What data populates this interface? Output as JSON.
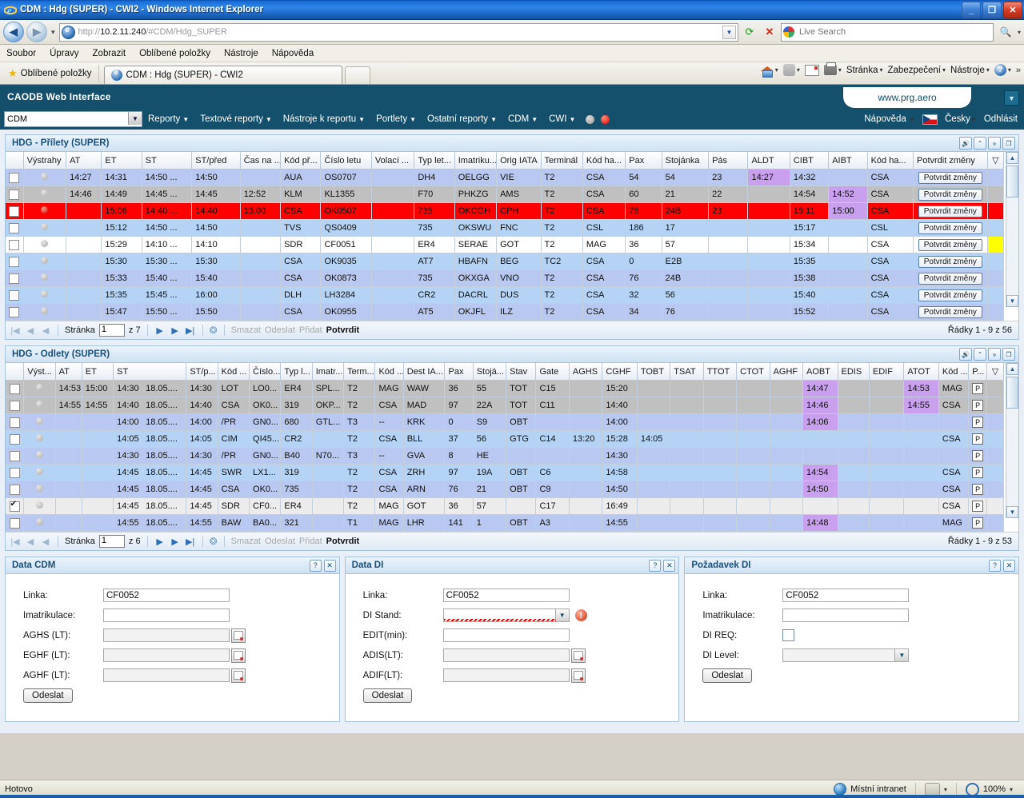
{
  "browser": {
    "title": "CDM : Hdg (SUPER) - CWI2 - Windows Internet Explorer",
    "url_scheme": "http://",
    "url_host": "10.2.11.240",
    "url_path": "/#CDM/Hdg_SUPER",
    "search_placeholder": "Live Search",
    "menu": [
      "Soubor",
      "Úpravy",
      "Zobrazit",
      "Oblíbené položky",
      "Nástroje",
      "Nápověda"
    ],
    "favorites_label": "Oblíbené položky",
    "tab_label": "CDM : Hdg (SUPER) - CWI2",
    "command_bar": [
      "Stránka",
      "Zabezpečení",
      "Nástroje"
    ],
    "status_text": "Hotovo",
    "zone_text": "Místní intranet",
    "zoom_level": "100%"
  },
  "app": {
    "header_title": "CAODB Web Interface",
    "brand": "www.prg.aero",
    "module_select": "CDM",
    "menu": [
      "Reporty",
      "Textové reporty",
      "Nástroje k reportu",
      "Portlety",
      "Ostatní reporty",
      "CDM",
      "CWI"
    ],
    "help_label": "Nápověda",
    "language": "Česky",
    "logout": "Odhlásit"
  },
  "arrivals": {
    "title": "HDG - Přílety (SUPER)",
    "columns": [
      "",
      "Výstrahy",
      "AT",
      "ET",
      "ST",
      "ST/před",
      "Čas na ...",
      "Kód př...",
      "Číslo letu",
      "Volací ...",
      "Typ let...",
      "Imatriku...",
      "Orig IATA",
      "Terminál",
      "Kód ha...",
      "Pax",
      "Stojánka",
      "Pás",
      "ALDT",
      "CIBT",
      "AIBT",
      "Kód ha...",
      "Potvrdit změny"
    ],
    "confirm_label": "Potvrdit změny",
    "rows": [
      {
        "style": "r-blue",
        "checked": false,
        "dot": "grey",
        "at": "14:27",
        "et": "14:31",
        "st": "14:50 ...",
        "stpred": "14:50",
        "casna": "",
        "kodpr": "AUA",
        "cislo": "OS0707",
        "volaci": "",
        "typ": "DH4",
        "imat": "OELGG",
        "orig": "VIE",
        "term": "T2",
        "kodha": "CSA",
        "pax": "54",
        "stoj": "54",
        "pas": "23",
        "aldt": "14:27",
        "cibt": "14:32",
        "aibt": "",
        "kodha2": "CSA",
        "aldt_hl": true,
        "aibt_hl": false,
        "flag": false
      },
      {
        "style": "r-grey",
        "checked": false,
        "dot": "grey",
        "at": "14:46",
        "et": "14:49",
        "st": "14:45 ...",
        "stpred": "14:45",
        "casna": "12:52",
        "kodpr": "KLM",
        "cislo": "KL1355",
        "volaci": "",
        "typ": "F70",
        "imat": "PHKZG",
        "orig": "AMS",
        "term": "T2",
        "kodha": "CSA",
        "pax": "60",
        "stoj": "21",
        "pas": "22",
        "aldt": "",
        "cibt": "14:54",
        "aibt": "14:52",
        "kodha2": "CSA",
        "aldt_hl": false,
        "aibt_hl": true,
        "flag": false
      },
      {
        "style": "r-red",
        "checked": false,
        "dot": "red",
        "at": "",
        "et": "15:06",
        "st": "14:40 ...",
        "stpred": "14:40",
        "casna": "13:00",
        "kodpr": "CSA",
        "cislo": "OK0507",
        "volaci": "",
        "typ": "735",
        "imat": "OKCGH",
        "orig": "CPH",
        "term": "T2",
        "kodha": "CSA",
        "pax": "76",
        "stoj": "24B",
        "pas": "23",
        "aldt": "",
        "cibt": "15:11",
        "aibt": "15:00",
        "kodha2": "CSA",
        "aldt_hl": false,
        "aibt_hl": true,
        "flag": false
      },
      {
        "style": "r-lblue",
        "checked": false,
        "dot": "grey",
        "at": "",
        "et": "15:12",
        "st": "14:50 ...",
        "stpred": "14:50",
        "casna": "",
        "kodpr": "TVS",
        "cislo": "QS0409",
        "volaci": "",
        "typ": "735",
        "imat": "OKSWU",
        "orig": "FNC",
        "term": "T2",
        "kodha": "CSL",
        "pax": "186",
        "stoj": "17",
        "pas": "",
        "aldt": "",
        "cibt": "15:17",
        "aibt": "",
        "kodha2": "CSL",
        "aldt_hl": false,
        "aibt_hl": false,
        "flag": false
      },
      {
        "style": "r-white",
        "checked": false,
        "dot": "grey",
        "at": "",
        "et": "15:29",
        "st": "14:10 ...",
        "stpred": "14:10",
        "casna": "",
        "kodpr": "SDR",
        "cislo": "CF0051",
        "volaci": "",
        "typ": "ER4",
        "imat": "SERAE",
        "orig": "GOT",
        "term": "T2",
        "kodha": "MAG",
        "pax": "36",
        "stoj": "57",
        "pas": "",
        "aldt": "",
        "cibt": "15:34",
        "aibt": "",
        "kodha2": "CSA",
        "aldt_hl": false,
        "aibt_hl": false,
        "flag": true
      },
      {
        "style": "r-lblue",
        "checked": false,
        "dot": "grey",
        "at": "",
        "et": "15:30",
        "st": "15:30 ...",
        "stpred": "15:30",
        "casna": "",
        "kodpr": "CSA",
        "cislo": "OK9035",
        "volaci": "",
        "typ": "AT7",
        "imat": "HBAFN",
        "orig": "BEG",
        "term": "TC2",
        "kodha": "CSA",
        "pax": "0",
        "stoj": "E2B",
        "pas": "",
        "aldt": "",
        "cibt": "15:35",
        "aibt": "",
        "kodha2": "CSA",
        "aldt_hl": false,
        "aibt_hl": false,
        "flag": false
      },
      {
        "style": "r-blue",
        "checked": false,
        "dot": "grey",
        "at": "",
        "et": "15:33",
        "st": "15:40 ...",
        "stpred": "15:40",
        "casna": "",
        "kodpr": "CSA",
        "cislo": "OK0873",
        "volaci": "",
        "typ": "735",
        "imat": "OKXGA",
        "orig": "VNO",
        "term": "T2",
        "kodha": "CSA",
        "pax": "76",
        "stoj": "24B",
        "pas": "",
        "aldt": "",
        "cibt": "15:38",
        "aibt": "",
        "kodha2": "CSA",
        "aldt_hl": false,
        "aibt_hl": false,
        "flag": false
      },
      {
        "style": "r-lblue",
        "checked": false,
        "dot": "grey",
        "at": "",
        "et": "15:35",
        "st": "15:45 ...",
        "stpred": "16:00",
        "casna": "",
        "kodpr": "DLH",
        "cislo": "LH3284",
        "volaci": "",
        "typ": "CR2",
        "imat": "DACRL",
        "orig": "DUS",
        "term": "T2",
        "kodha": "CSA",
        "pax": "32",
        "stoj": "56",
        "pas": "",
        "aldt": "",
        "cibt": "15:40",
        "aibt": "",
        "kodha2": "CSA",
        "aldt_hl": false,
        "aibt_hl": false,
        "flag": false
      },
      {
        "style": "r-blue",
        "checked": false,
        "dot": "grey",
        "at": "",
        "et": "15:47",
        "st": "15:50 ...",
        "stpred": "15:50",
        "casna": "",
        "kodpr": "CSA",
        "cislo": "OK0955",
        "volaci": "",
        "typ": "AT5",
        "imat": "OKJFL",
        "orig": "ILZ",
        "term": "T2",
        "kodha": "CSA",
        "pax": "34",
        "stoj": "76",
        "pas": "",
        "aldt": "",
        "cibt": "15:52",
        "aibt": "",
        "kodha2": "CSA",
        "aldt_hl": false,
        "aibt_hl": false,
        "flag": false
      }
    ],
    "pager": {
      "page_label": "Stránka",
      "page_value": "1",
      "of_label": "z 7",
      "actions": [
        "Smazat",
        "Odeslat",
        "Přidat",
        "Potvrdit"
      ],
      "rows_info": "Řádky 1 - 9 z 56"
    }
  },
  "departures": {
    "title": "HDG - Odlety (SUPER)",
    "columns": [
      "",
      "Výst...",
      "AT",
      "ET",
      "ST",
      "ST/p...",
      "Kód ...",
      "Číslo...",
      "Typ l...",
      "Imatr...",
      "Term...",
      "Kód ...",
      "Dest IA...",
      "Pax",
      "Stojá...",
      "Stav",
      "Gate",
      "AGHS",
      "CGHF",
      "TOBT",
      "TSAT",
      "TTOT",
      "CTOT",
      "AGHF",
      "AOBT",
      "EDIS",
      "EDIF",
      "ATOT",
      "Kód ...",
      "P..."
    ],
    "rows": [
      {
        "style": "r-grey",
        "checked": false,
        "dot": "grey",
        "at": "14:53",
        "et": "15:00",
        "st": "14:30",
        "st_date": "18.05....",
        "stp": "14:30",
        "kod": "LOT",
        "cislo": "LO0...",
        "typ": "ER4",
        "imat": "SPL...",
        "term": "T2",
        "kodha": "MAG",
        "dest": "WAW",
        "pax": "36",
        "stoj": "55",
        "stav": "TOT",
        "gate": "C15",
        "aghs": "",
        "cghf": "15:20",
        "tobt": "",
        "tsat": "",
        "ttot": "",
        "ctot": "",
        "aghf": "",
        "aobt": "14:47",
        "edis": "",
        "edif": "",
        "atot": "14:53",
        "kod2": "MAG",
        "aobt_hl": true,
        "atot_hl": true
      },
      {
        "style": "r-grey",
        "checked": false,
        "dot": "grey",
        "at": "14:55",
        "et": "14:55",
        "st": "14:40",
        "st_date": "18.05....",
        "stp": "14:40",
        "kod": "CSA",
        "cislo": "OK0...",
        "typ": "319",
        "imat": "OKP...",
        "term": "T2",
        "kodha": "CSA",
        "dest": "MAD",
        "pax": "97",
        "stoj": "22A",
        "stav": "TOT",
        "gate": "C11",
        "aghs": "",
        "cghf": "14:40",
        "tobt": "",
        "tsat": "",
        "ttot": "",
        "ctot": "",
        "aghf": "",
        "aobt": "14:46",
        "edis": "",
        "edif": "",
        "atot": "14:55",
        "kod2": "CSA",
        "aobt_hl": true,
        "atot_hl": true
      },
      {
        "style": "r-blue",
        "checked": false,
        "dot": "grey",
        "at": "",
        "et": "",
        "st": "14:00",
        "st_date": "18.05....",
        "stp": "14:00",
        "kod": "/PR",
        "cislo": "GN0...",
        "typ": "680",
        "imat": "GTL...",
        "term": "T3",
        "kodha": "--",
        "dest": "KRK",
        "pax": "0",
        "stoj": "S9",
        "stav": "OBT",
        "gate": "",
        "aghs": "",
        "cghf": "14:00",
        "tobt": "",
        "tsat": "",
        "ttot": "",
        "ctot": "",
        "aghf": "",
        "aobt": "14:06",
        "edis": "",
        "edif": "",
        "atot": "",
        "kod2": "",
        "aobt_hl": true,
        "atot_hl": false
      },
      {
        "style": "r-lblue",
        "checked": false,
        "dot": "grey",
        "at": "",
        "et": "",
        "st": "14:05",
        "st_date": "18.05....",
        "stp": "14:05",
        "kod": "CIM",
        "cislo": "QI45...",
        "typ": "CR2",
        "imat": "",
        "term": "T2",
        "kodha": "CSA",
        "dest": "BLL",
        "pax": "37",
        "stoj": "56",
        "stav": "GTG",
        "gate": "C14",
        "aghs": "13:20",
        "cghf": "15:28",
        "tobt": "14:05",
        "tsat": "",
        "ttot": "",
        "ctot": "",
        "aghf": "",
        "aobt": "",
        "edis": "",
        "edif": "",
        "atot": "",
        "kod2": "CSA",
        "aobt_hl": false,
        "atot_hl": false
      },
      {
        "style": "r-blue",
        "checked": false,
        "dot": "grey",
        "at": "",
        "et": "",
        "st": "14:30",
        "st_date": "18.05....",
        "stp": "14:30",
        "kod": "/PR",
        "cislo": "GN0...",
        "typ": "B40",
        "imat": "N70...",
        "term": "T3",
        "kodha": "--",
        "dest": "GVA",
        "pax": "8",
        "stoj": "HE",
        "stav": "",
        "gate": "",
        "aghs": "",
        "cghf": "14:30",
        "tobt": "",
        "tsat": "",
        "ttot": "",
        "ctot": "",
        "aghf": "",
        "aobt": "",
        "edis": "",
        "edif": "",
        "atot": "",
        "kod2": "",
        "aobt_hl": false,
        "atot_hl": false
      },
      {
        "style": "r-lblue",
        "checked": false,
        "dot": "grey",
        "at": "",
        "et": "",
        "st": "14:45",
        "st_date": "18.05....",
        "stp": "14:45",
        "kod": "SWR",
        "cislo": "LX1...",
        "typ": "319",
        "imat": "",
        "term": "T2",
        "kodha": "CSA",
        "dest": "ZRH",
        "pax": "97",
        "stoj": "19A",
        "stav": "OBT",
        "gate": "C6",
        "aghs": "",
        "cghf": "14:58",
        "tobt": "",
        "tsat": "",
        "ttot": "",
        "ctot": "",
        "aghf": "",
        "aobt": "14:54",
        "edis": "",
        "edif": "",
        "atot": "",
        "kod2": "CSA",
        "aobt_hl": true,
        "atot_hl": false
      },
      {
        "style": "r-blue",
        "checked": false,
        "dot": "grey",
        "at": "",
        "et": "",
        "st": "14:45",
        "st_date": "18.05....",
        "stp": "14:45",
        "kod": "CSA",
        "cislo": "OK0...",
        "typ": "735",
        "imat": "",
        "term": "T2",
        "kodha": "CSA",
        "dest": "ARN",
        "pax": "76",
        "stoj": "21",
        "stav": "OBT",
        "gate": "C9",
        "aghs": "",
        "cghf": "14:50",
        "tobt": "",
        "tsat": "",
        "ttot": "",
        "ctot": "",
        "aghf": "",
        "aobt": "14:50",
        "edis": "",
        "edif": "",
        "atot": "",
        "kod2": "CSA",
        "aobt_hl": true,
        "atot_hl": false
      },
      {
        "style": "r-ltgrey",
        "checked": true,
        "dot": "grey",
        "at": "",
        "et": "",
        "st": "14:45",
        "st_date": "18.05....",
        "stp": "14:45",
        "kod": "SDR",
        "cislo": "CF0...",
        "typ": "ER4",
        "imat": "",
        "term": "T2",
        "kodha": "MAG",
        "dest": "GOT",
        "pax": "36",
        "stoj": "57",
        "stav": "",
        "gate": "C17",
        "aghs": "",
        "cghf": "16:49",
        "tobt": "",
        "tsat": "",
        "ttot": "",
        "ctot": "",
        "aghf": "",
        "aobt": "",
        "edis": "",
        "edif": "",
        "atot": "",
        "kod2": "CSA",
        "aobt_hl": false,
        "atot_hl": false
      },
      {
        "style": "r-blue",
        "checked": false,
        "dot": "grey",
        "at": "",
        "et": "",
        "st": "14:55",
        "st_date": "18.05....",
        "stp": "14:55",
        "kod": "BAW",
        "cislo": "BA0...",
        "typ": "321",
        "imat": "",
        "term": "T1",
        "kodha": "MAG",
        "dest": "LHR",
        "pax": "141",
        "stoj": "1",
        "stav": "OBT",
        "gate": "A3",
        "aghs": "",
        "cghf": "14:55",
        "tobt": "",
        "tsat": "",
        "ttot": "",
        "ctot": "",
        "aghf": "",
        "aobt": "14:48",
        "edis": "",
        "edif": "",
        "atot": "",
        "kod2": "MAG",
        "aobt_hl": true,
        "atot_hl": false
      }
    ],
    "pager": {
      "page_label": "Stránka",
      "page_value": "1",
      "of_label": "z 6",
      "actions": [
        "Smazat",
        "Odeslat",
        "Přidat",
        "Potvrdit"
      ],
      "rows_info": "Řádky 1 - 9 z 53"
    }
  },
  "panel_data_cdm": {
    "title": "Data CDM",
    "fields": [
      {
        "label": "Linka:",
        "value": "CF0052",
        "type": "text"
      },
      {
        "label": "Imatrikulace:",
        "value": "",
        "type": "text"
      },
      {
        "label": "AGHS (LT):",
        "value": "",
        "type": "date"
      },
      {
        "label": "EGHF (LT):",
        "value": "",
        "type": "date"
      },
      {
        "label": "AGHF (LT):",
        "value": "",
        "type": "date"
      }
    ],
    "submit_label": "Odeslat"
  },
  "panel_data_di": {
    "title": "Data DI",
    "fields": [
      {
        "label": "Linka:",
        "value": "CF0052",
        "type": "text"
      },
      {
        "label": "DI Stand:",
        "value": "",
        "type": "select-error"
      },
      {
        "label": "EDIT(min):",
        "value": "",
        "type": "text"
      },
      {
        "label": "ADIS(LT):",
        "value": "",
        "type": "date"
      },
      {
        "label": "ADIF(LT):",
        "value": "",
        "type": "date"
      }
    ],
    "submit_label": "Odeslat"
  },
  "panel_pozadavek_di": {
    "title": "Požadavek DI",
    "fields": [
      {
        "label": "Linka:",
        "value": "CF0052",
        "type": "text"
      },
      {
        "label": "Imatrikulace:",
        "value": "",
        "type": "text"
      },
      {
        "label": "DI REQ:",
        "value": "",
        "type": "checkbox"
      },
      {
        "label": "DI Level:",
        "value": "",
        "type": "select"
      }
    ],
    "submit_label": "Odeslat"
  }
}
